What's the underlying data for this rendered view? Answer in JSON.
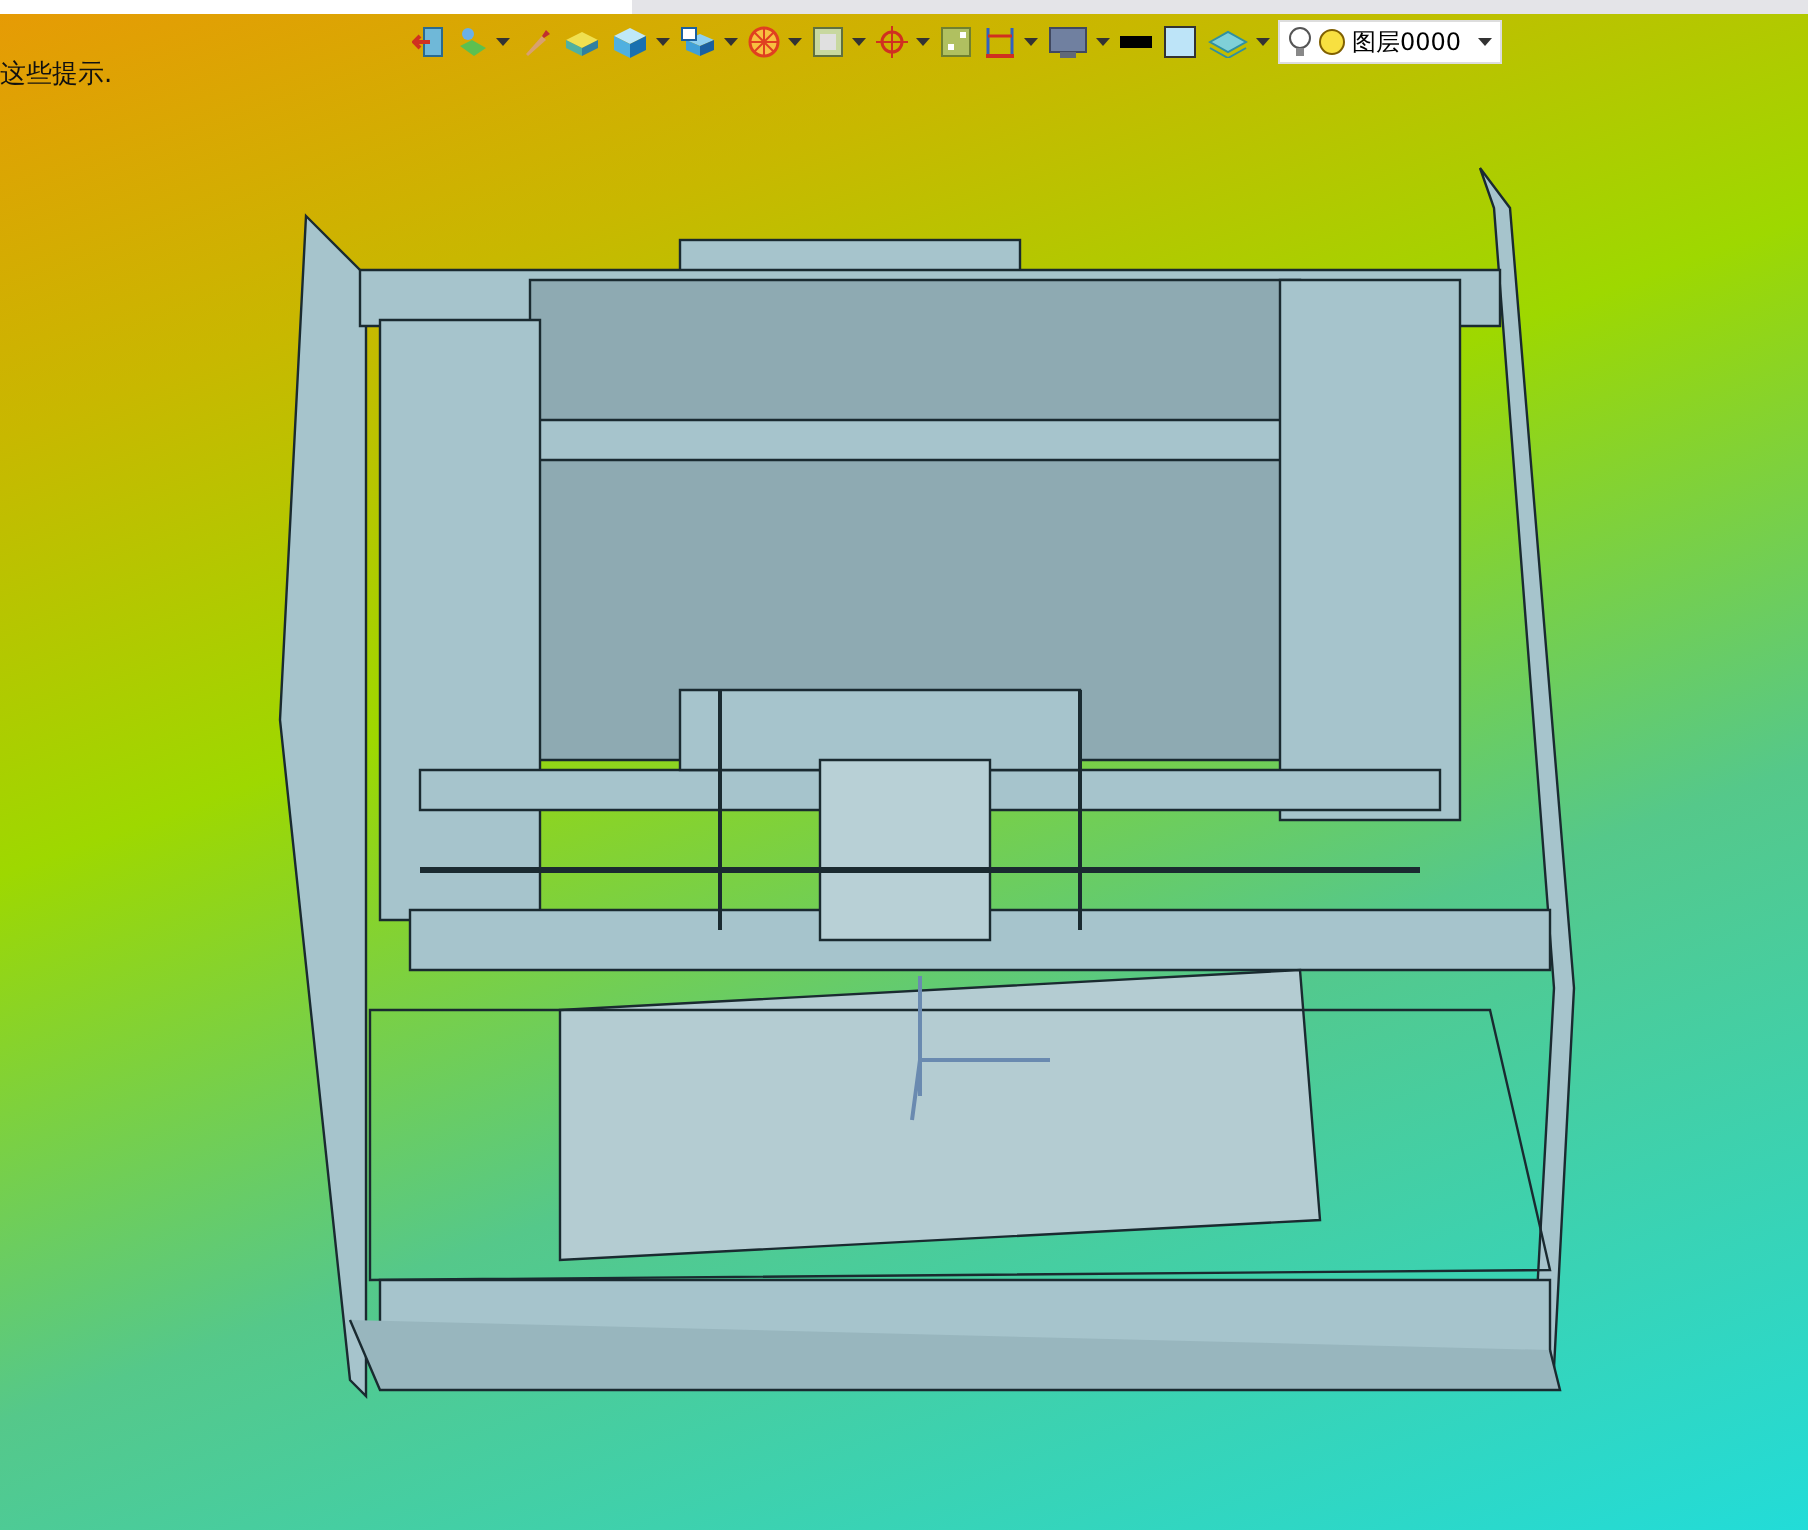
{
  "hint": "这些提示.",
  "toolbar": [
    {
      "kind": "exit",
      "dropdown": false
    },
    {
      "kind": "pointer",
      "dropdown": true
    },
    {
      "kind": "brush",
      "dropdown": false
    },
    {
      "kind": "box",
      "dropdown": false
    },
    {
      "kind": "cube",
      "dropdown": true
    },
    {
      "kind": "view",
      "dropdown": true
    },
    {
      "kind": "wheel",
      "dropdown": true
    },
    {
      "kind": "image",
      "dropdown": true
    },
    {
      "kind": "target",
      "dropdown": true
    },
    {
      "kind": "picture",
      "dropdown": false
    },
    {
      "kind": "dimension",
      "dropdown": true
    },
    {
      "kind": "monitor",
      "dropdown": true
    },
    {
      "kind": "line",
      "dropdown": false
    },
    {
      "kind": "fill",
      "dropdown": false
    },
    {
      "kind": "layers",
      "dropdown": true
    }
  ],
  "layer_select": {
    "value": "图层0000"
  }
}
